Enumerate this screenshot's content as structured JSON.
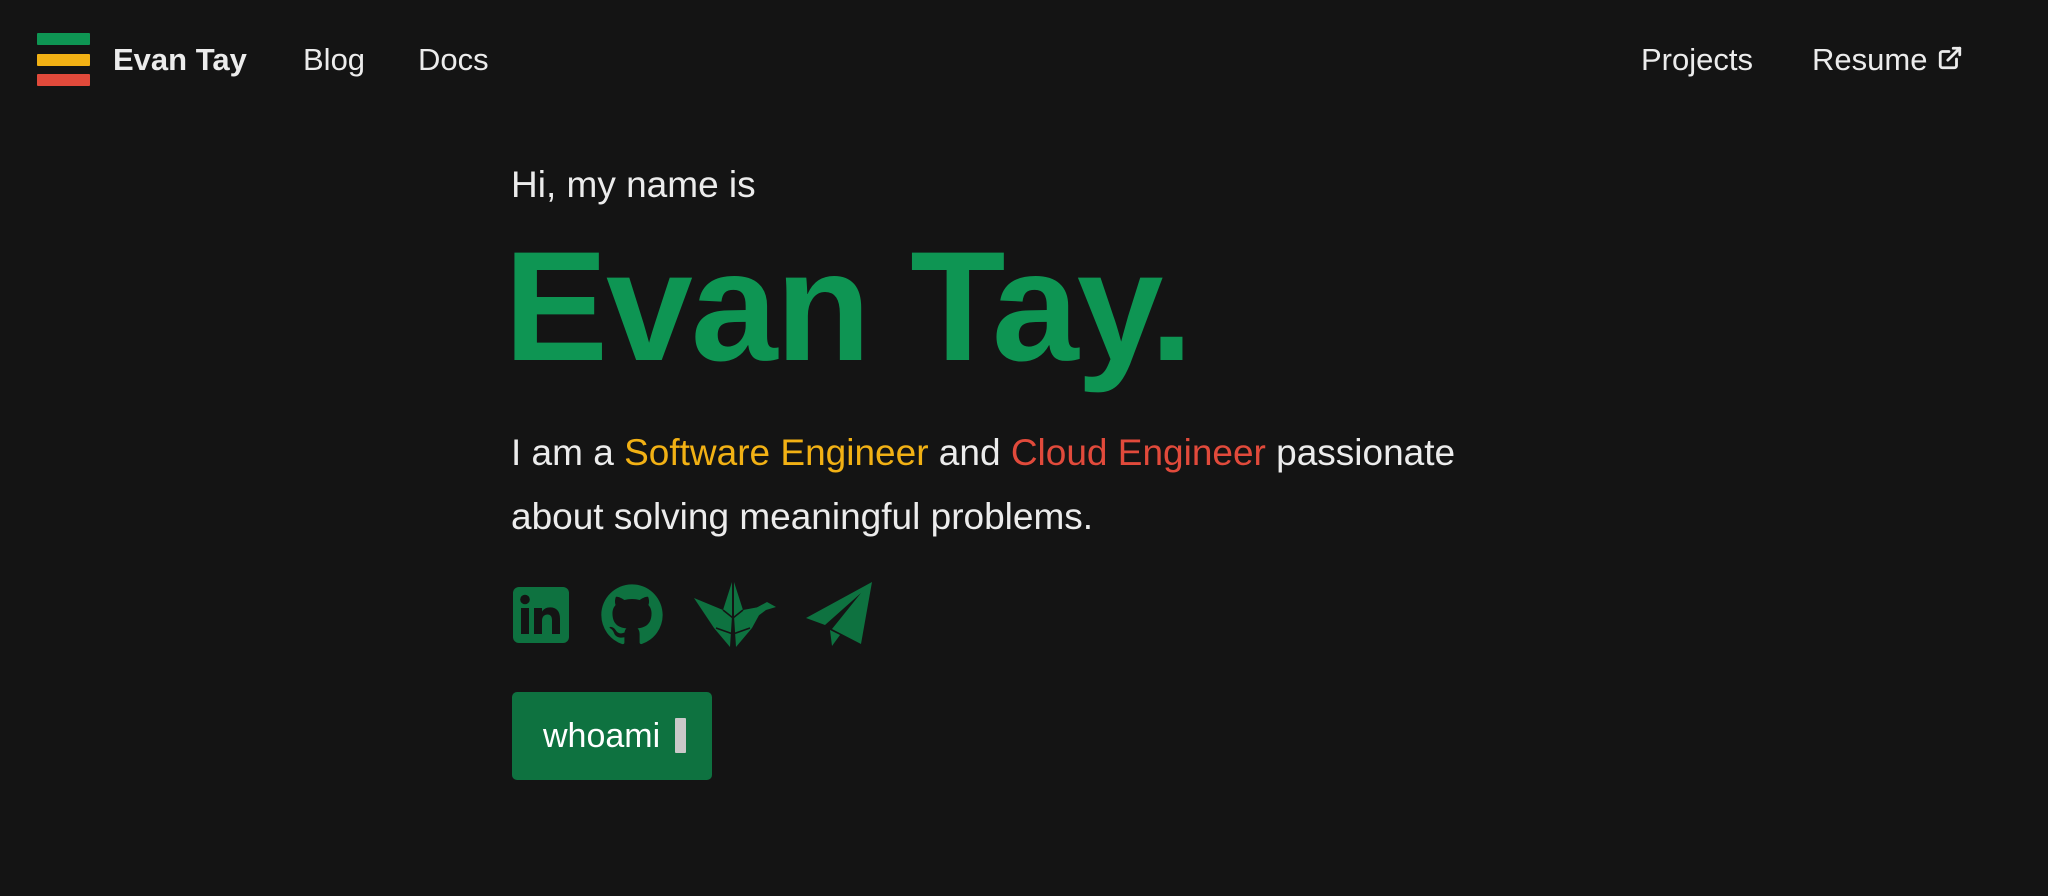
{
  "nav": {
    "brand": "Evan Tay",
    "links": [
      {
        "label": "Blog"
      },
      {
        "label": "Docs"
      }
    ],
    "right_links": [
      {
        "label": "Projects"
      },
      {
        "label": "Resume",
        "icon": "external-link-icon"
      }
    ],
    "logo_colors": [
      "#0e9553",
      "#f2b114",
      "#e14a3b"
    ]
  },
  "hero": {
    "greeting": "Hi, my name is",
    "name": "Evan Tay.",
    "tagline": {
      "prefix": "I am a ",
      "role_1": "Software Engineer",
      "connector": " and ",
      "role_2": "Cloud Engineer",
      "suffix": " passionate about solving meaningful problems."
    },
    "colors": {
      "accent": "#0e9553",
      "role_1": "#f2b114",
      "role_2": "#e14a3b",
      "button": "#0e7240"
    }
  },
  "socials": [
    {
      "icon": "linkedin-icon"
    },
    {
      "icon": "github-icon"
    },
    {
      "icon": "origami-crane-icon"
    },
    {
      "icon": "telegram-icon"
    }
  ],
  "cta": {
    "label": "whoami"
  }
}
